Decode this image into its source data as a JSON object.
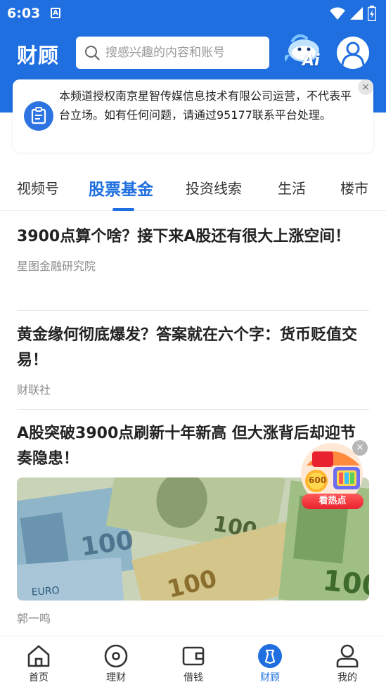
{
  "status_bar": {
    "time": "6:03",
    "sim_letter": "A",
    "icons": [
      "wifi-icon",
      "signal-icon",
      "battery-icon"
    ]
  },
  "header": {
    "brand": "财顾",
    "search_placeholder": "搜感兴趣的内容和账号",
    "ai_label": "Ai",
    "icons": [
      "search-icon",
      "ai-mascot-icon",
      "avatar-icon"
    ]
  },
  "notice": {
    "text": "本频道授权南京星智传媒信息技术有限公司运营，不代表平台立场。如有任何问题，请通过95177联系平台处理。",
    "close_symbol": "×"
  },
  "tabs": [
    {
      "label": "视频号",
      "active": false
    },
    {
      "label": "股票基金",
      "active": true
    },
    {
      "label": "投资线索",
      "active": false
    },
    {
      "label": "生活",
      "active": false
    },
    {
      "label": "楼市",
      "active": false
    }
  ],
  "articles": [
    {
      "title": "3900点算个啥？接下来A股还有很大上涨空间！",
      "source": "星图金融研究院"
    },
    {
      "title": "黄金缘何彻底爆发？答案就在六个字：货币贬值交易！",
      "source": "财联社"
    },
    {
      "title": "A股突破3900点刷新十年新高 但大涨背后却迎节奏隐患！",
      "source": "郭一鸣",
      "image": "euro-and-dollar-banknotes-photo"
    }
  ],
  "floating_widget": {
    "coins": "600",
    "label": "看热点",
    "close_symbol": "×"
  },
  "bottom_nav": [
    {
      "label": "首页",
      "icon": "home-icon",
      "active": false
    },
    {
      "label": "理财",
      "icon": "wealth-icon",
      "active": false
    },
    {
      "label": "借钱",
      "icon": "wallet-icon",
      "active": false
    },
    {
      "label": "财顾",
      "icon": "advisor-icon",
      "active": true
    },
    {
      "label": "我的",
      "icon": "profile-icon",
      "active": false
    }
  ],
  "colors": {
    "primary": "#1f6fe0",
    "text": "#222222",
    "muted": "#8a8a8a",
    "hot_badge": "#e8222e"
  }
}
